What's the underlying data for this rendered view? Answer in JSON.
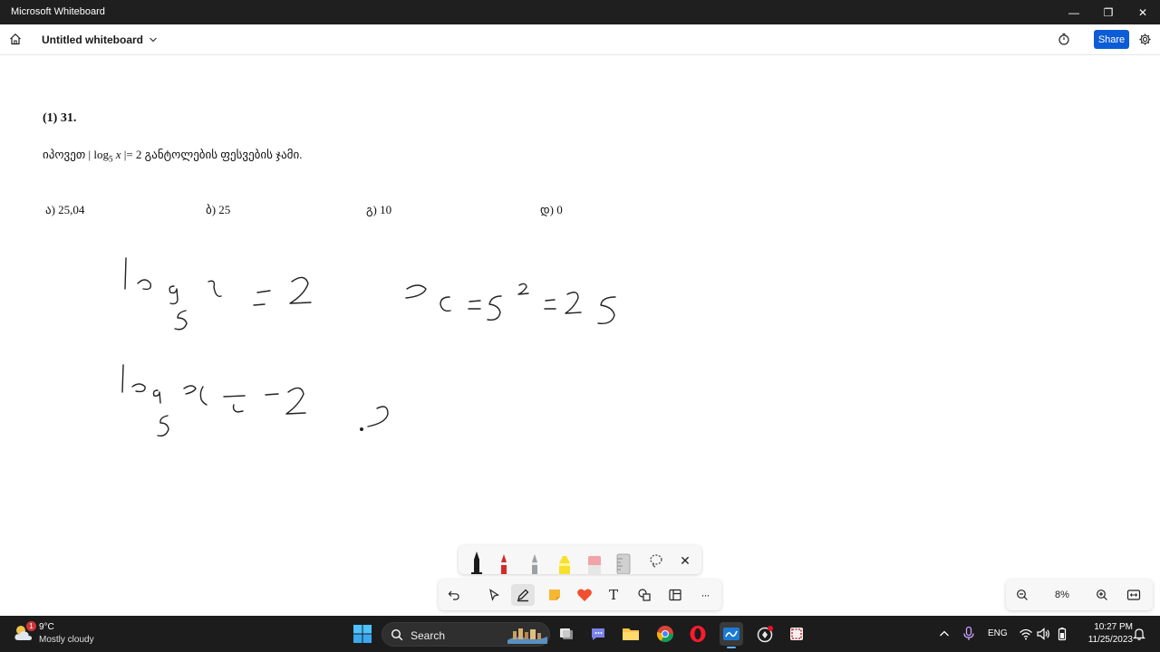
{
  "window": {
    "app_title": "Microsoft Whiteboard",
    "minimize_glyph": "—",
    "maximize_glyph": "❐",
    "close_glyph": "✕"
  },
  "header": {
    "board_title": "Untitled whiteboard",
    "share_label": "Share"
  },
  "problem": {
    "number": "(1) 31.",
    "prompt_before": "იპოვეთ | ",
    "log_word": "log",
    "log_base": "5",
    "variable": "x",
    "prompt_after": " |= 2 განტოლების ფესვების ჯამი.",
    "answers": [
      {
        "label": "ა) 25,04"
      },
      {
        "label": "ბ) 25"
      },
      {
        "label": "გ)  10"
      },
      {
        "label": "დ) 0"
      }
    ]
  },
  "pen_palette": {
    "tools": [
      {
        "name": "black-pen",
        "color": "#1a1a1a"
      },
      {
        "name": "red-pen",
        "color": "#d42a2a"
      },
      {
        "name": "blue-pen",
        "color": "#1f6fd1"
      },
      {
        "name": "yellow-highlighter",
        "color": "#f5e12b"
      },
      {
        "name": "eraser",
        "color": "#f2a3a8"
      },
      {
        "name": "ruler",
        "color": "#c8c8c8"
      },
      {
        "name": "lasso-select",
        "color": "#444444"
      }
    ],
    "close_glyph": "✕"
  },
  "toolbar": {
    "undo_glyph": "↶",
    "more_glyph": "···",
    "text_glyph": "T"
  },
  "zoom": {
    "level": "8%"
  },
  "taskbar": {
    "weather_temp": "9°C",
    "weather_desc": "Mostly cloudy",
    "weather_badge": "1",
    "search_label": "Search",
    "language": "ENG",
    "time": "10:27 PM",
    "date": "11/25/2023"
  }
}
